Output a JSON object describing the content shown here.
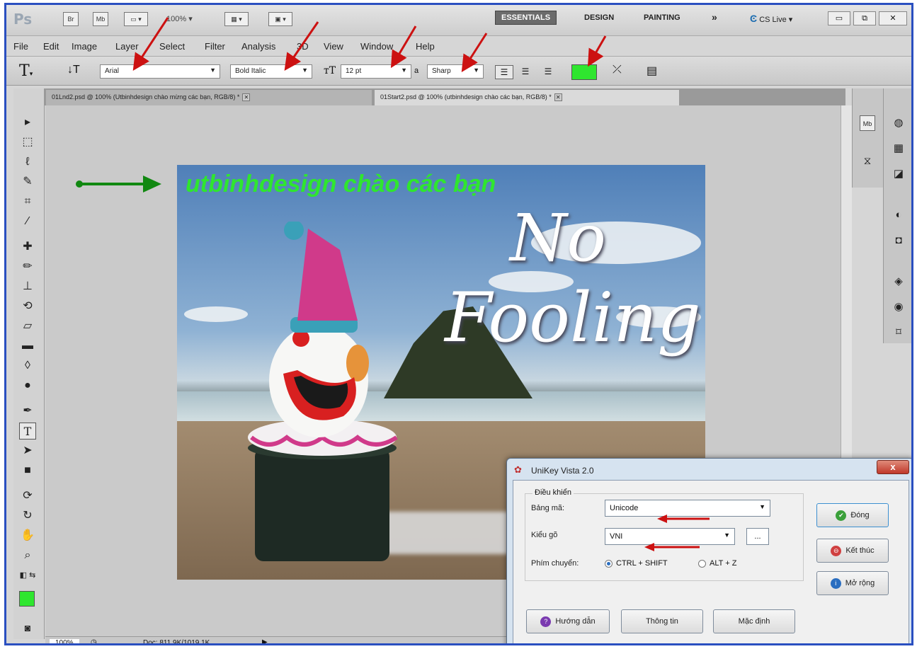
{
  "app": {
    "logo": "Ps",
    "bar_icons": [
      "Br",
      "Mb"
    ],
    "zoom": "100%",
    "workspaces": [
      "ESSENTIALS",
      "DESIGN",
      "PAINTING"
    ],
    "more": "»",
    "cs_live": "CS Live ▾"
  },
  "menu": [
    "File",
    "Edit",
    "Image",
    "Layer",
    "Select",
    "Filter",
    "Analysis",
    "3D",
    "View",
    "Window",
    "Help"
  ],
  "options": {
    "font_family": "Arial",
    "font_style": "Bold Italic",
    "font_size": "12 pt",
    "antialias_label": "a",
    "antialias": "Sharp",
    "text_color": "#2fe62f"
  },
  "tabs": [
    {
      "label": "01Lnd2.psd @ 100% (Utbinhdesign chào mừng các bạn, RGB/8) *"
    },
    {
      "label": "01Start2.psd @ 100% (utbinhdesign chào các bạn, RGB/8) *"
    }
  ],
  "canvas": {
    "text_layer": "utbinhdesign chào các bạn",
    "art_line1": "No",
    "art_line2": "Fooling"
  },
  "status": {
    "zoom": "100%",
    "doc": "Doc: 811.9K/1019.1K"
  },
  "colors": {
    "foreground": "#2fe62f",
    "background": "#ffffff",
    "arrow_red": "#cc1111",
    "arrow_green": "#118811"
  },
  "unikey": {
    "title": "UniKey Vista 2.0",
    "close": "x",
    "group_label": "Điều khiển",
    "charset_label": "Bảng mã:",
    "charset_value": "Unicode",
    "input_label": "Kiểu gõ",
    "input_value": "VNI",
    "more_dots": "...",
    "switch_label": "Phím chuyển:",
    "switch_opt1": "CTRL + SHIFT",
    "switch_opt2": "ALT + Z",
    "btn_close": "Đóng",
    "btn_exit": "Kết thúc",
    "btn_expand": "Mở rộng",
    "btn_help": "Hướng dẫn",
    "btn_info": "Thông tin",
    "btn_default": "Mặc định"
  }
}
